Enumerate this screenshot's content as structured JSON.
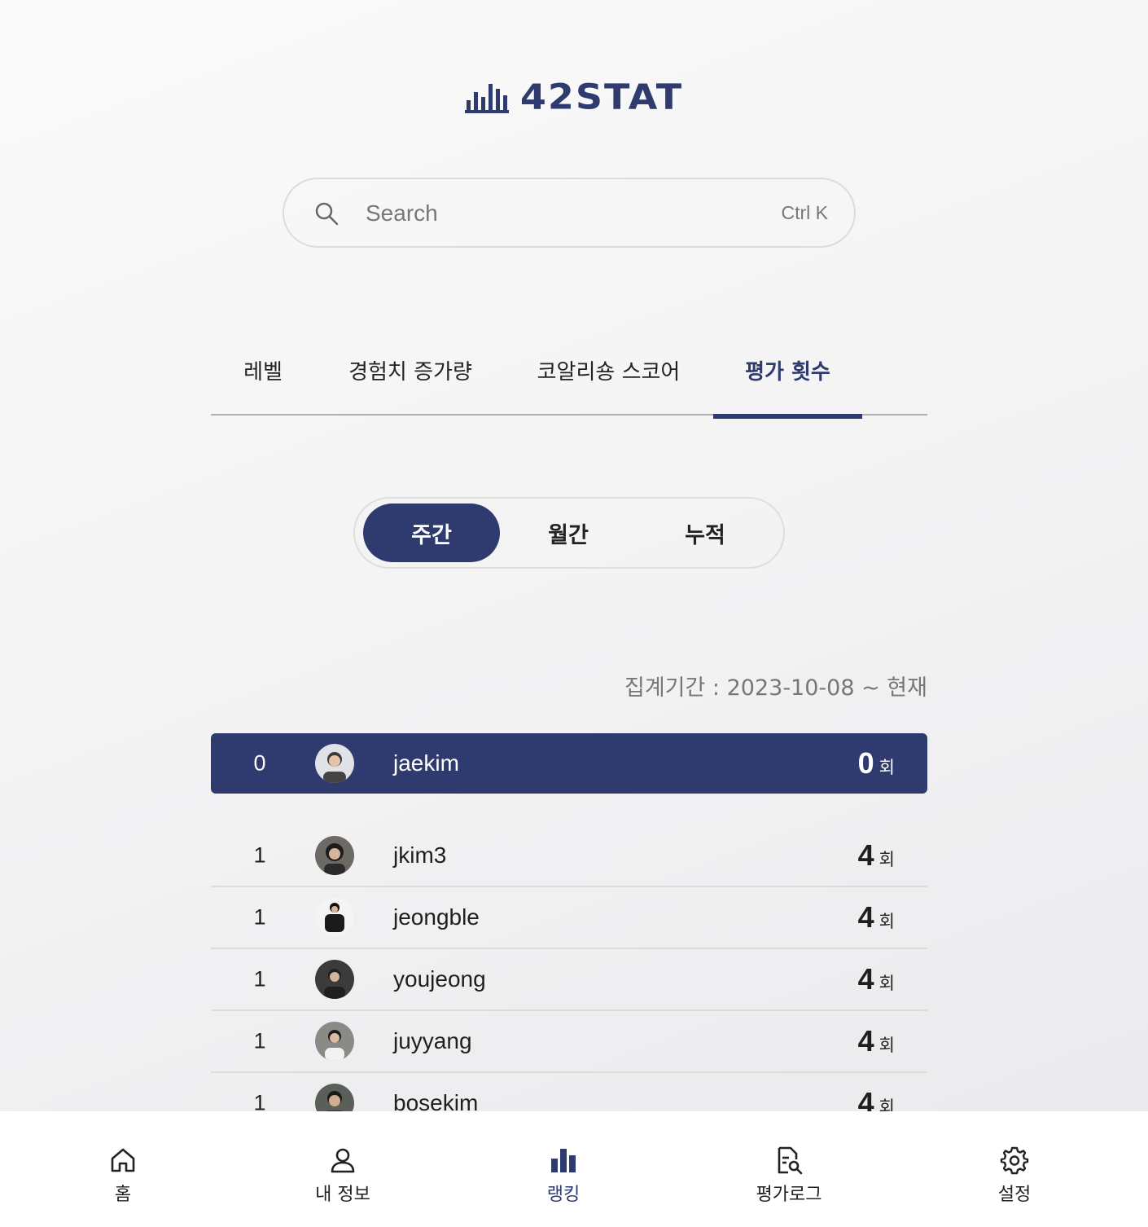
{
  "brand": {
    "name": "42STAT",
    "color": "#2f3a6f"
  },
  "search": {
    "placeholder": "Search",
    "shortcut": "Ctrl K",
    "icon": "search-icon"
  },
  "tabs": [
    {
      "label": "레벨",
      "active": false
    },
    {
      "label": "경험치 증가량",
      "active": false
    },
    {
      "label": "코알리숑 스코어",
      "active": false
    },
    {
      "label": "평가 횟수",
      "active": true
    }
  ],
  "periods": [
    {
      "label": "주간",
      "active": true
    },
    {
      "label": "월간",
      "active": false
    },
    {
      "label": "누적",
      "active": false
    }
  ],
  "range_text": "집계기간 : 2023-10-08 ~ 현재",
  "my_rank": {
    "rank": "0",
    "name": "jaekim",
    "score": "0",
    "unit": "회"
  },
  "ranking": [
    {
      "rank": "1",
      "name": "jkim3",
      "score": "4",
      "unit": "회"
    },
    {
      "rank": "1",
      "name": "jeongble",
      "score": "4",
      "unit": "회"
    },
    {
      "rank": "1",
      "name": "youjeong",
      "score": "4",
      "unit": "회"
    },
    {
      "rank": "1",
      "name": "juyyang",
      "score": "4",
      "unit": "회"
    },
    {
      "rank": "1",
      "name": "bosekim",
      "score": "4",
      "unit": "회"
    }
  ],
  "nav": [
    {
      "label": "홈",
      "icon": "home-icon",
      "active": false
    },
    {
      "label": "내 정보",
      "icon": "user-icon",
      "active": false
    },
    {
      "label": "랭킹",
      "icon": "bar-chart-icon",
      "active": true
    },
    {
      "label": "평가로그",
      "icon": "document-search-icon",
      "active": false
    },
    {
      "label": "설정",
      "icon": "gear-icon",
      "active": false
    }
  ]
}
